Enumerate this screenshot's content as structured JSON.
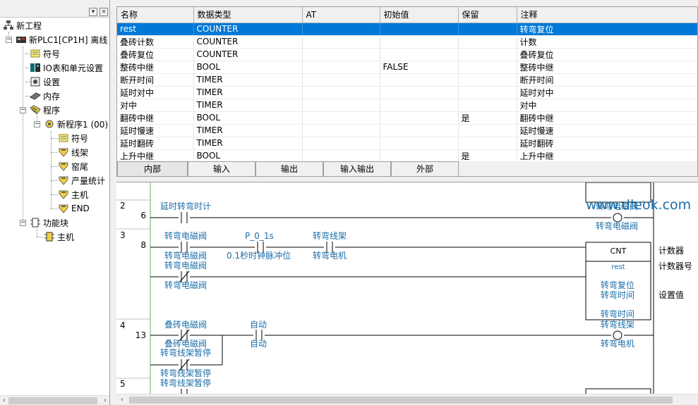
{
  "tree": {
    "project": "新工程",
    "plc": "新PLC1[CP1H] 离线",
    "symbols": "符号",
    "io_table": "IO表和单元设置",
    "settings": "设置",
    "memory": "内存",
    "programs": "程序",
    "program1": "新程序1 (00)",
    "sections": [
      "符号",
      "线架",
      "窑尾",
      "产量统计",
      "主机",
      "END"
    ],
    "function_blocks": "功能块",
    "fb_main": "主机"
  },
  "table": {
    "headers": [
      "名称",
      "数据类型",
      "AT",
      "初始值",
      "保留",
      "注释"
    ],
    "rows": [
      [
        "rest",
        "COUNTER",
        "",
        "",
        "",
        "转弯复位"
      ],
      [
        "叠砖计数",
        "COUNTER",
        "",
        "",
        "",
        "计数"
      ],
      [
        "叠砖复位",
        "COUNTER",
        "",
        "",
        "",
        "叠砖复位"
      ],
      [
        "整砖中继",
        "BOOL",
        "",
        "FALSE",
        "",
        "整砖中继"
      ],
      [
        "断开时间",
        "TIMER",
        "",
        "",
        "",
        "断开时间"
      ],
      [
        "延时对中",
        "TIMER",
        "",
        "",
        "",
        "延时对中"
      ],
      [
        "对中",
        "TIMER",
        "",
        "",
        "",
        "对中"
      ],
      [
        "翻砖中继",
        "BOOL",
        "",
        "",
        "是",
        "翻砖中继"
      ],
      [
        "延时慢速",
        "TIMER",
        "",
        "",
        "",
        "延时慢速"
      ],
      [
        "延时翻砖",
        "TIMER",
        "",
        "",
        "",
        "延时翻砖"
      ],
      [
        "上升中继",
        "BOOL",
        "",
        "",
        "是",
        "上升中继"
      ]
    ],
    "tabs": [
      "内部",
      "输入",
      "输出",
      "输入输出",
      "外部"
    ]
  },
  "ladder": {
    "watermark": "www.dleok.com",
    "rungs": [
      {
        "num": "2",
        "step": "6",
        "contact1": "延时转弯时计",
        "coil_top": "转弯电磁阀",
        "coil_bottom": "转弯电磁阀"
      },
      {
        "num": "3",
        "step": "8",
        "c1_top": "转弯电磁阀",
        "c1_bottom": "转弯电磁阀",
        "c2_top": "P_0_1s",
        "c2_bottom": "0.1秒时钟脉冲位",
        "c3_top": "转弯线架",
        "c3_bottom": "转弯电机",
        "c4_top": "转弯电磁阀",
        "c4_bottom": "转弯电磁阀",
        "fb_title": "CNT",
        "fb_instance": "rest",
        "fb_in1": "转弯复位",
        "fb_in2": "转弯时间",
        "fb_in3": "转弯时间",
        "out1": "计数器",
        "out2": "计数器号",
        "out3": "设置值"
      },
      {
        "num": "4",
        "step": "13",
        "c1_top": "叠砖电磁阀",
        "c1_bottom": "叠砖电磁阀",
        "c2_top": "自动",
        "c2_bottom": "自动",
        "c3_top": "转弯线架暂停",
        "c3_bottom": "转弯线架暂停",
        "coil_top": "转弯线架",
        "coil_bottom": "转弯电机"
      },
      {
        "num": "5",
        "step": "17",
        "c1_top": "转弯线架暂停"
      }
    ]
  },
  "colors": {
    "selection": "#0078d7",
    "ladder_text": "#1a6ea8",
    "rail": "#000000"
  }
}
